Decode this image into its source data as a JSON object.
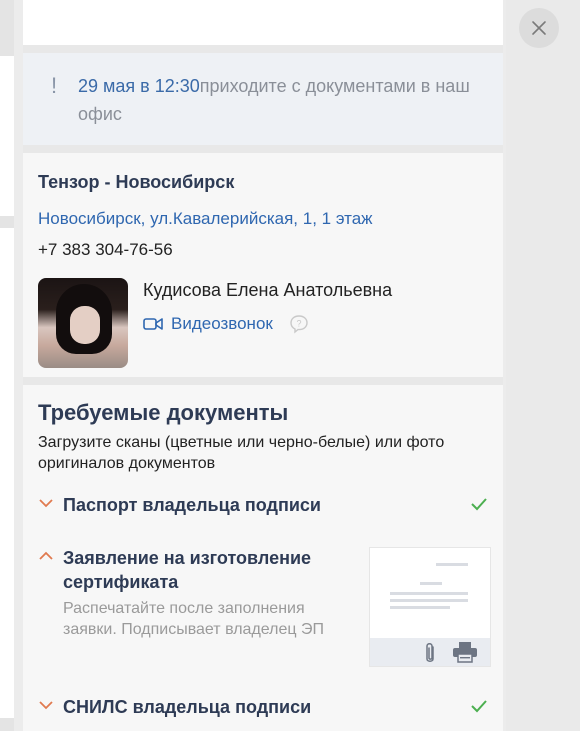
{
  "notice": {
    "date": "29 мая в 12:30",
    "message": "приходите с документами в наш офис"
  },
  "office": {
    "title": "Тензор - Новосибирск",
    "address": "Новосибирск, ул.Кавалерийская, 1, 1 этаж",
    "phone": "+7 383 304-76-56",
    "contact_name": "Кудисова Елена Анатольевна",
    "video_call_label": "Видеозвонок"
  },
  "documents": {
    "title": "Требуемые документы",
    "description": "Загрузите сканы (цветные или черно-белые) или фото оригиналов документов",
    "items": [
      {
        "name": "Паспорт владельца подписи",
        "status": "done",
        "expanded": false
      },
      {
        "name": "Заявление на изготовление сертификата",
        "hint": "Распечатайте после заполнения заявки. Подписывает владелец ЭП",
        "status": "pending",
        "expanded": true
      },
      {
        "name": "СНИЛС владельца подписи",
        "status": "done",
        "expanded": false
      }
    ]
  },
  "colors": {
    "accent_blue": "#2f67b0",
    "heading": "#2e3b55",
    "chevron": "#e07a4f",
    "check": "#4caf50"
  },
  "icons": {
    "close": "close-icon",
    "video": "video-camera-icon",
    "help": "question-bubble-icon",
    "attach": "paperclip-icon",
    "print": "printer-icon"
  }
}
